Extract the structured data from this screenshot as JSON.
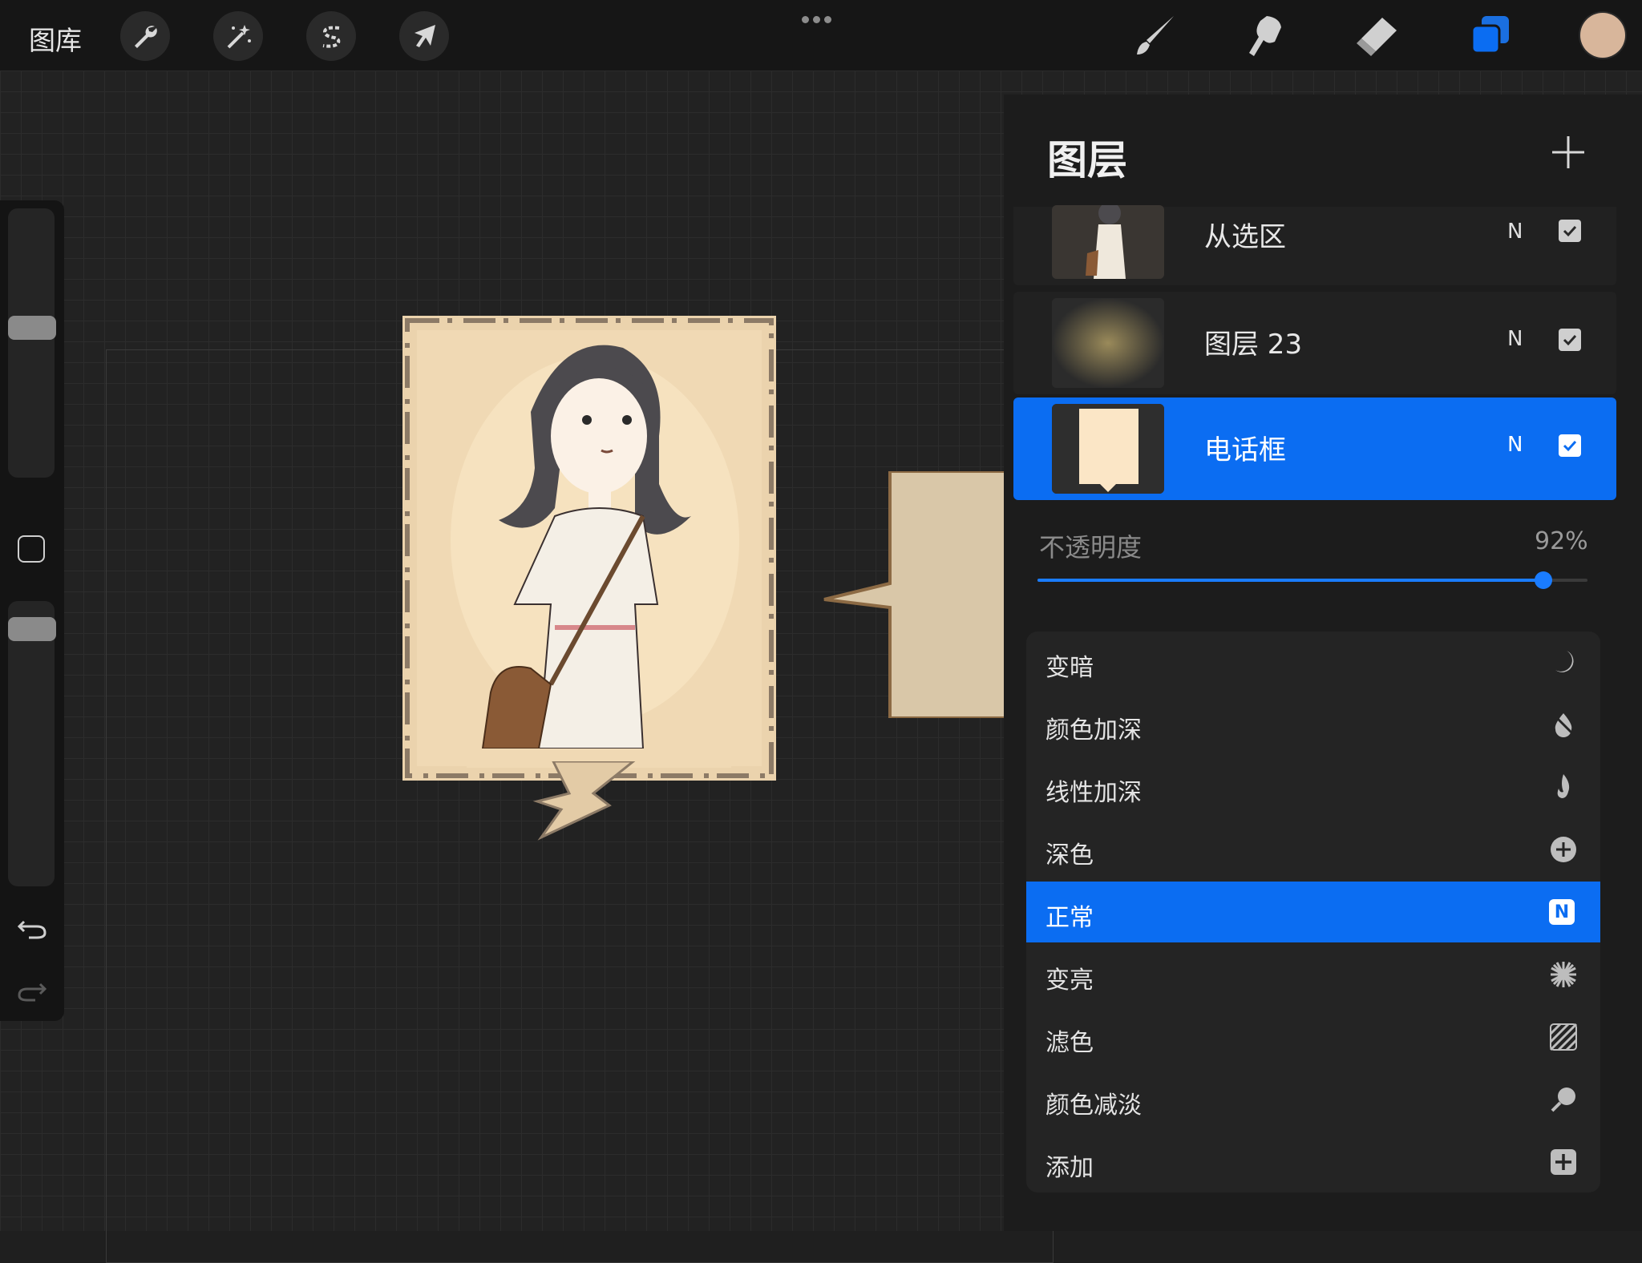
{
  "topbar": {
    "gallery_label": "图库",
    "tools_left": [
      {
        "name": "actions",
        "icon": "wrench-icon"
      },
      {
        "name": "adjustments",
        "icon": "magic-wand-icon"
      },
      {
        "name": "selection",
        "icon": "selection-s-icon"
      },
      {
        "name": "transform",
        "icon": "arrow-cursor-icon"
      }
    ],
    "tools_right": [
      {
        "name": "brush",
        "icon": "brush-icon"
      },
      {
        "name": "smudge",
        "icon": "smudge-finger-icon"
      },
      {
        "name": "eraser",
        "icon": "eraser-icon"
      },
      {
        "name": "layers",
        "icon": "layers-icon",
        "active": true
      }
    ],
    "current_color": "#d8b69b",
    "accent_color": "#0b6df2"
  },
  "layers_panel": {
    "title": "图层",
    "layers": [
      {
        "name": "从选区",
        "mode": "N",
        "visible": true,
        "selected": false
      },
      {
        "name": "图层 23",
        "mode": "N",
        "visible": true,
        "selected": false
      },
      {
        "name": "电话框",
        "mode": "N",
        "visible": true,
        "selected": true
      }
    ],
    "opacity": {
      "label": "不透明度",
      "value_text": "92%",
      "value": 0.92
    },
    "blend_modes": [
      {
        "label": "变暗",
        "icon": "moon-icon",
        "selected": false
      },
      {
        "label": "颜色加深",
        "icon": "burn-drop-icon",
        "selected": false
      },
      {
        "label": "线性加深",
        "icon": "flame-icon",
        "selected": false
      },
      {
        "label": "深色",
        "icon": "plus-circle-icon",
        "selected": false
      },
      {
        "label": "正常",
        "icon": "n-badge-icon",
        "icon_text": "N",
        "selected": true
      },
      {
        "label": "变亮",
        "icon": "sun-burst-icon",
        "selected": false
      },
      {
        "label": "滤色",
        "icon": "hatch-icon",
        "selected": false
      },
      {
        "label": "颜色减淡",
        "icon": "dodge-icon",
        "selected": false
      },
      {
        "label": "添加",
        "icon": "plus-square-icon",
        "selected": false
      }
    ]
  }
}
